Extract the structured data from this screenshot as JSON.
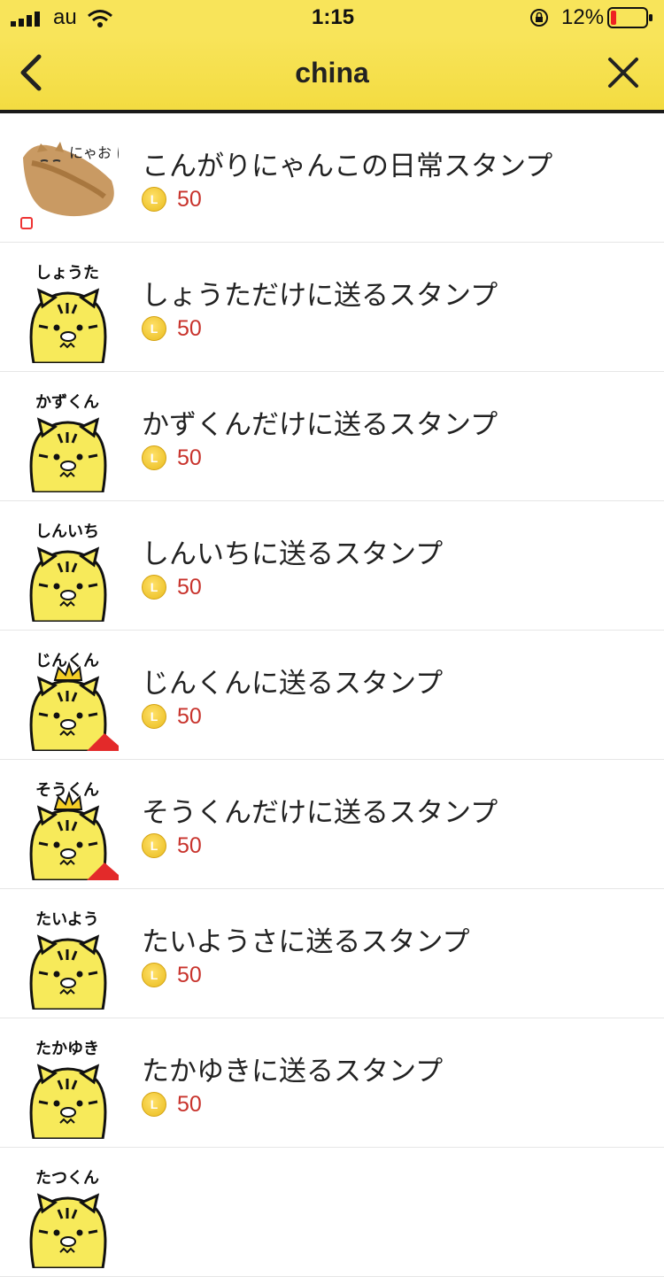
{
  "status": {
    "carrier": "au",
    "time": "1:15",
    "battery": "12%"
  },
  "nav": {
    "title": "china"
  },
  "colors": {
    "nav_bg": "#f3dc41",
    "price": "#c8332c",
    "coin": "#e9bb1c",
    "tiger": "#f7ea5a"
  },
  "items": [
    {
      "title": "こんがりにゃんこの日常スタンプ",
      "price": "50",
      "thumb_caption": "",
      "thumb_kind": "cat",
      "logo_text": "にゃお にゃお"
    },
    {
      "title": "しょうただけに送るスタンプ",
      "price": "50",
      "thumb_caption": "しょうた",
      "thumb_kind": "tiger"
    },
    {
      "title": "かずくんだけに送るスタンプ",
      "price": "50",
      "thumb_caption": "かずくん",
      "thumb_kind": "tiger"
    },
    {
      "title": "しんいちに送るスタンプ",
      "price": "50",
      "thumb_caption": "しんいち",
      "thumb_kind": "tiger"
    },
    {
      "title": "じんくんに送るスタンプ",
      "price": "50",
      "thumb_caption": "じんくん",
      "thumb_kind": "tiger-crown"
    },
    {
      "title": "そうくんだけに送るスタンプ",
      "price": "50",
      "thumb_caption": "そうくん",
      "thumb_kind": "tiger-crown"
    },
    {
      "title": "たいようさに送るスタンプ",
      "price": "50",
      "thumb_caption": "たいよう",
      "thumb_kind": "tiger"
    },
    {
      "title": "たかゆきに送るスタンプ",
      "price": "50",
      "thumb_caption": "たかゆき",
      "thumb_kind": "tiger"
    },
    {
      "title": "",
      "price": "",
      "thumb_caption": "たつくん",
      "thumb_kind": "tiger"
    }
  ]
}
